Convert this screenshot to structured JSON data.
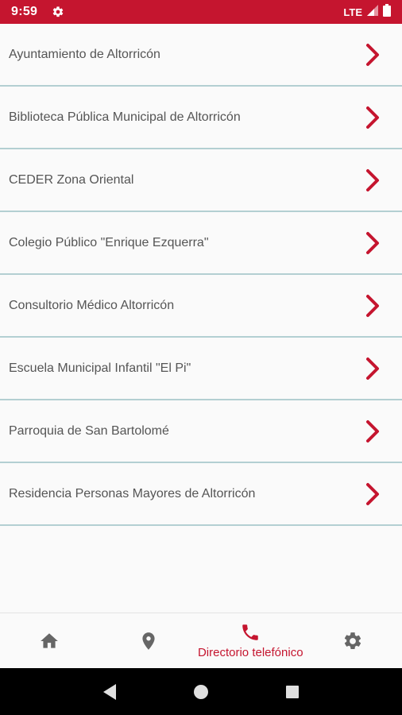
{
  "status_bar": {
    "time": "9:59",
    "network": "LTE"
  },
  "list": {
    "items": [
      {
        "label": "Ayuntamiento de Altorricón"
      },
      {
        "label": "Biblioteca Pública Municipal de Altorricón"
      },
      {
        "label": "CEDER Zona Oriental"
      },
      {
        "label": "Colegio Público \"Enrique Ezquerra\""
      },
      {
        "label": "Consultorio Médico Altorricón"
      },
      {
        "label": "Escuela Municipal Infantil \"El Pi\""
      },
      {
        "label": "Parroquia de San Bartolomé"
      },
      {
        "label": "Residencia Personas Mayores de Altorricón"
      }
    ]
  },
  "bottom_nav": {
    "items": [
      {
        "icon": "home-icon"
      },
      {
        "icon": "location-pin-icon"
      },
      {
        "icon": "phone-icon",
        "label": "Directorio telefónico",
        "active": true
      },
      {
        "icon": "settings-gear-icon"
      }
    ]
  },
  "colors": {
    "accent": "#c5152f",
    "divider": "#b3cfd2",
    "icon_gray": "#666666"
  }
}
